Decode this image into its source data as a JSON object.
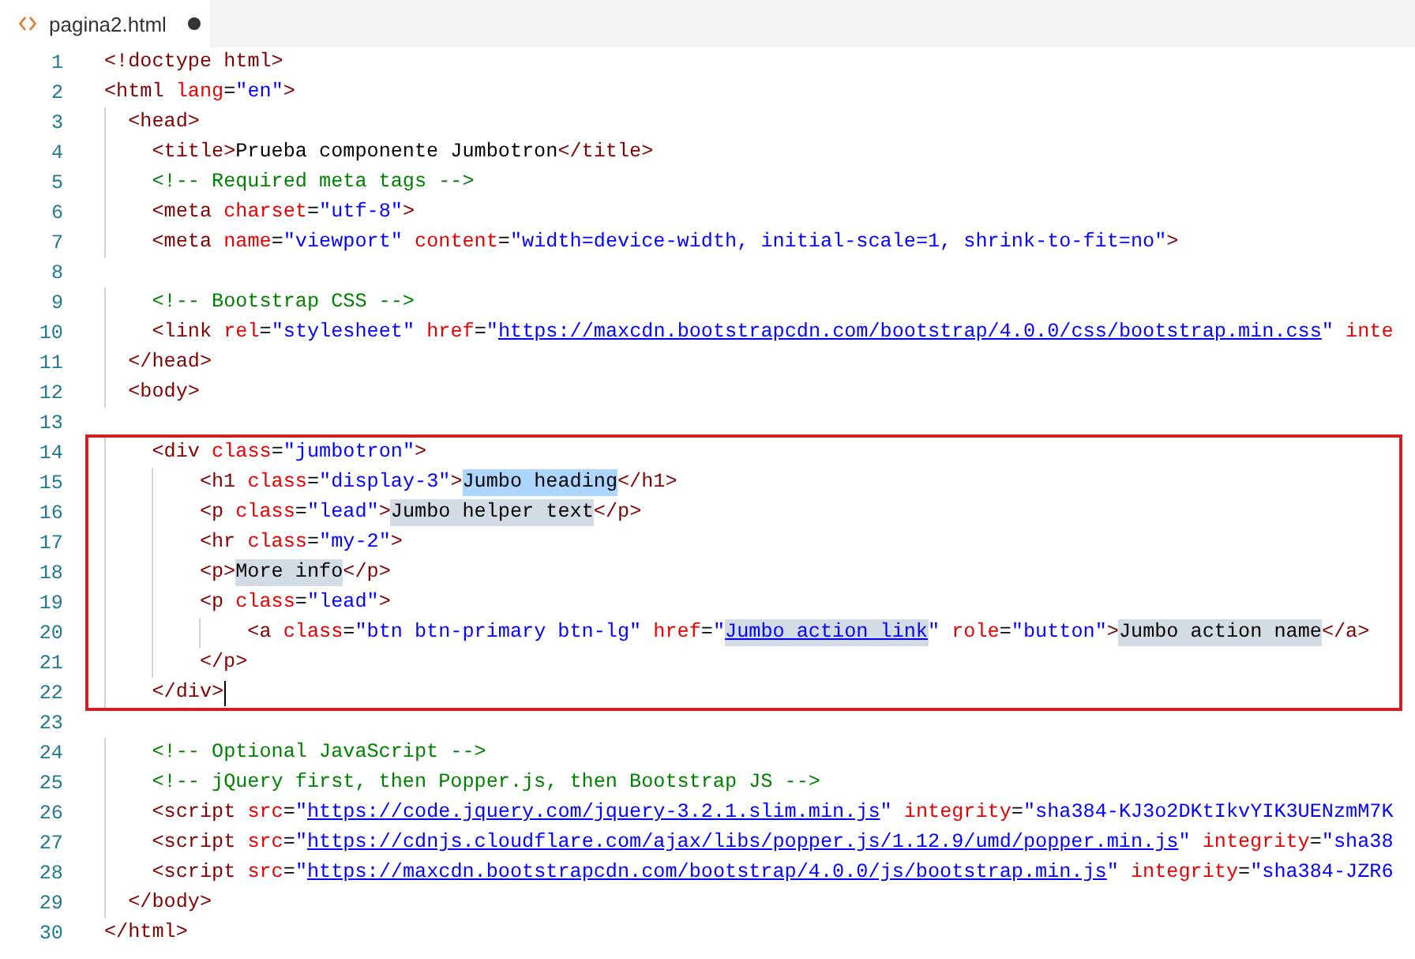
{
  "tab": {
    "label": "pagina2.html",
    "modified": true
  },
  "lines": [
    {
      "number": "1",
      "tokens": [
        {
          "kind": "tag",
          "text": "<!doctype html>"
        }
      ]
    },
    {
      "number": "2",
      "tokens": [
        {
          "kind": "tag",
          "text": "<html"
        },
        {
          "kind": "attr",
          "text": " lang="
        },
        {
          "kind": "string",
          "text": "\"en\""
        },
        {
          "kind": "tag",
          "text": ">"
        }
      ]
    },
    {
      "number": "3",
      "tokens": [
        {
          "kind": "tag",
          "text": "  <head>"
        }
      ]
    },
    {
      "number": "4",
      "tokens": [
        {
          "kind": "tag",
          "text": "    <title>"
        },
        {
          "kind": "text",
          "text": "Prueba componente Jumbotron"
        },
        {
          "kind": "tag",
          "text": "</title>"
        }
      ]
    },
    {
      "number": "5",
      "tokens": [
        {
          "kind": "comment",
          "text": "    <!-- Required meta tags -->"
        }
      ]
    },
    {
      "number": "6",
      "tokens": [
        {
          "kind": "tag",
          "text": "    <meta"
        },
        {
          "kind": "attr",
          "text": " charset="
        },
        {
          "kind": "string",
          "text": "\"utf-8\""
        },
        {
          "kind": "tag",
          "text": ">"
        }
      ]
    },
    {
      "number": "7",
      "tokens": [
        {
          "kind": "tag",
          "text": "    <meta"
        },
        {
          "kind": "attr",
          "text": " name="
        },
        {
          "kind": "string",
          "text": "\"viewport\""
        },
        {
          "kind": "attr",
          "text": " content="
        },
        {
          "kind": "string",
          "text": "\"width=device-width, initial-scale=1, shrink-to-fit=no\""
        },
        {
          "kind": "tag",
          "text": ">"
        }
      ]
    },
    {
      "number": "8"
    },
    {
      "number": "9",
      "tokens": [
        {
          "kind": "comment",
          "text": "    <!-- Bootstrap CSS -->"
        }
      ]
    },
    {
      "number": "10",
      "tokens": [
        {
          "kind": "tag",
          "text": "    <link"
        },
        {
          "kind": "attr",
          "text": " rel="
        },
        {
          "kind": "string",
          "text": "\"stylesheet\""
        },
        {
          "kind": "attr",
          "text": " href="
        },
        {
          "kind": "string",
          "text": "\""
        },
        {
          "kind": "link",
          "text": "https://maxcdn.bootstrapcdn.com/bootstrap/4.0.0/css/bootstrap.min.css"
        },
        {
          "kind": "string",
          "text": "\""
        },
        {
          "kind": "attr",
          "text": " inte"
        }
      ]
    },
    {
      "number": "11",
      "tokens": [
        {
          "kind": "tag",
          "text": "  </head>"
        }
      ]
    },
    {
      "number": "12",
      "tokens": [
        {
          "kind": "tag",
          "text": "  <body>"
        }
      ]
    },
    {
      "number": "13"
    },
    {
      "number": "14",
      "framed": true,
      "tokens": [
        {
          "kind": "tag",
          "text": "    <div"
        },
        {
          "kind": "attr",
          "text": " class="
        },
        {
          "kind": "string",
          "text": "\"jumbotron\""
        },
        {
          "kind": "tag",
          "text": ">"
        }
      ]
    },
    {
      "number": "15",
      "framed": true,
      "tokens": [
        {
          "kind": "tag",
          "text": "        <h1"
        },
        {
          "kind": "attr",
          "text": " class="
        },
        {
          "kind": "string",
          "text": "\"display-3\""
        },
        {
          "kind": "tag",
          "text": ">"
        },
        {
          "kind": "text",
          "text": "Jumbo heading",
          "selected": true
        },
        {
          "kind": "tag",
          "text": "</h1>"
        }
      ]
    },
    {
      "number": "16",
      "framed": true,
      "tokens": [
        {
          "kind": "tag",
          "text": "        <p"
        },
        {
          "kind": "attr",
          "text": " class="
        },
        {
          "kind": "string",
          "text": "\"lead\""
        },
        {
          "kind": "tag",
          "text": ">"
        },
        {
          "kind": "text",
          "text": "Jumbo helper text",
          "highlighted": true
        },
        {
          "kind": "tag",
          "text": "</p>"
        }
      ]
    },
    {
      "number": "17",
      "framed": true,
      "tokens": [
        {
          "kind": "tag",
          "text": "        <hr"
        },
        {
          "kind": "attr",
          "text": " class="
        },
        {
          "kind": "string",
          "text": "\"my-2\""
        },
        {
          "kind": "tag",
          "text": ">"
        }
      ]
    },
    {
      "number": "18",
      "framed": true,
      "tokens": [
        {
          "kind": "tag",
          "text": "        <p>"
        },
        {
          "kind": "text",
          "text": "More info",
          "highlighted": true
        },
        {
          "kind": "tag",
          "text": "</p>"
        }
      ]
    },
    {
      "number": "19",
      "framed": true,
      "tokens": [
        {
          "kind": "tag",
          "text": "        <p"
        },
        {
          "kind": "attr",
          "text": " class="
        },
        {
          "kind": "string",
          "text": "\"lead\""
        },
        {
          "kind": "tag",
          "text": ">"
        }
      ]
    },
    {
      "number": "20",
      "framed": true,
      "tokens": [
        {
          "kind": "tag",
          "text": "            <a"
        },
        {
          "kind": "attr",
          "text": " class="
        },
        {
          "kind": "string",
          "text": "\"btn btn-primary btn-lg\""
        },
        {
          "kind": "attr",
          "text": " href="
        },
        {
          "kind": "string",
          "text": "\""
        },
        {
          "kind": "link",
          "text": "Jumbo action link",
          "highlighted": true
        },
        {
          "kind": "string",
          "text": "\""
        },
        {
          "kind": "attr",
          "text": " role="
        },
        {
          "kind": "string",
          "text": "\"button\""
        },
        {
          "kind": "tag",
          "text": ">"
        },
        {
          "kind": "text",
          "text": "Jumbo action name",
          "highlighted": true
        },
        {
          "kind": "tag",
          "text": "</a>"
        }
      ]
    },
    {
      "number": "21",
      "framed": true,
      "tokens": [
        {
          "kind": "tag",
          "text": "        </p>"
        }
      ]
    },
    {
      "number": "22",
      "framed": true,
      "cursor": true,
      "tokens": [
        {
          "kind": "tag",
          "text": "    </div>"
        }
      ]
    },
    {
      "number": "23"
    },
    {
      "number": "24",
      "tokens": [
        {
          "kind": "comment",
          "text": "    <!-- Optional JavaScript -->"
        }
      ]
    },
    {
      "number": "25",
      "tokens": [
        {
          "kind": "comment",
          "text": "    <!-- jQuery first, then Popper.js, then Bootstrap JS -->"
        }
      ]
    },
    {
      "number": "26",
      "tokens": [
        {
          "kind": "tag",
          "text": "    <script"
        },
        {
          "kind": "attr",
          "text": " src="
        },
        {
          "kind": "string",
          "text": "\""
        },
        {
          "kind": "link",
          "text": "https://code.jquery.com/jquery-3.2.1.slim.min.js"
        },
        {
          "kind": "string",
          "text": "\""
        },
        {
          "kind": "attr",
          "text": " integrity="
        },
        {
          "kind": "string",
          "text": "\"sha384-KJ3o2DKtIkvYIK3UENzmM7K"
        }
      ]
    },
    {
      "number": "27",
      "tokens": [
        {
          "kind": "tag",
          "text": "    <script"
        },
        {
          "kind": "attr",
          "text": " src="
        },
        {
          "kind": "string",
          "text": "\""
        },
        {
          "kind": "link",
          "text": "https://cdnjs.cloudflare.com/ajax/libs/popper.js/1.12.9/umd/popper.min.js"
        },
        {
          "kind": "string",
          "text": "\""
        },
        {
          "kind": "attr",
          "text": " integrity="
        },
        {
          "kind": "string",
          "text": "\"sha38"
        }
      ]
    },
    {
      "number": "28",
      "tokens": [
        {
          "kind": "tag",
          "text": "    <script"
        },
        {
          "kind": "attr",
          "text": " src="
        },
        {
          "kind": "string",
          "text": "\""
        },
        {
          "kind": "link",
          "text": "https://maxcdn.bootstrapcdn.com/bootstrap/4.0.0/js/bootstrap.min.js"
        },
        {
          "kind": "string",
          "text": "\""
        },
        {
          "kind": "attr",
          "text": " integrity="
        },
        {
          "kind": "string",
          "text": "\"sha384-JZR6"
        }
      ]
    },
    {
      "number": "29",
      "tokens": [
        {
          "kind": "tag",
          "text": "  </body>"
        }
      ]
    },
    {
      "number": "30",
      "tokens": [
        {
          "kind": "tag",
          "text": "</html>"
        }
      ]
    }
  ]
}
